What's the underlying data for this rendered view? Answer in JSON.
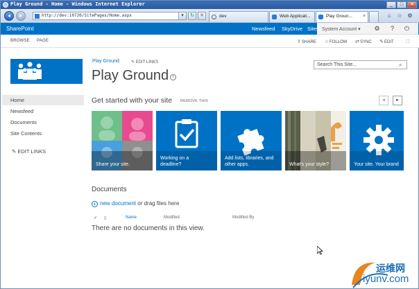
{
  "window": {
    "title": "Play Ground - Home - Windows Internet Explorer",
    "minimize": "_",
    "maximize": "□",
    "close": "✕"
  },
  "browser": {
    "address": "http://dev:10720/SitePages/Home.aspx",
    "tabs": [
      {
        "label": "dev"
      },
      {
        "label": "Web Applicati..."
      },
      {
        "label": "Play Groun..."
      }
    ]
  },
  "suite": {
    "brand": "SharePoint",
    "links": [
      "Newsfeed",
      "SkyDrive",
      "Sites"
    ],
    "account": "System Account ▾"
  },
  "ribbon": {
    "tabs": [
      "BROWSE",
      "PAGE"
    ],
    "actions": [
      "SHARE",
      "FOLLOW",
      "SYNC",
      "EDIT"
    ]
  },
  "leftnav": {
    "items": [
      "Home",
      "Newsfeed",
      "Documents",
      "Site Contents"
    ],
    "edit_links": "EDIT LINKS"
  },
  "header": {
    "breadcrumb": "Play Ground",
    "edit_links": "EDIT LINKS",
    "title": "Play Ground",
    "info": "i"
  },
  "search": {
    "placeholder": "Search This Site..."
  },
  "getstarted": {
    "title": "Get started with your site",
    "remove": "REMOVE THIS",
    "prev": "◂",
    "next": "▸",
    "tiles": [
      {
        "line1": "Share your site.",
        "line2": ""
      },
      {
        "line1": "Working on a",
        "line2": "deadline?"
      },
      {
        "line1": "Add lists, libraries, and",
        "line2": "other apps."
      },
      {
        "line1": "What's your style?",
        "line2": ""
      },
      {
        "line1": "Your site. Your brand",
        "line2": ""
      }
    ]
  },
  "documents": {
    "title": "Documents",
    "new_link": "new document",
    "new_suffix": " or drag files here",
    "columns": [
      "Name",
      "Modified",
      "Modified By"
    ],
    "empty": "There are no documents in this view."
  },
  "watermark": {
    "line1": "运维网",
    "line2": "iyunv.com"
  },
  "colors": {
    "brand_blue": "#0072c6",
    "tile_green": "#6fbf8b",
    "tile_pink": "#e84a8f"
  }
}
